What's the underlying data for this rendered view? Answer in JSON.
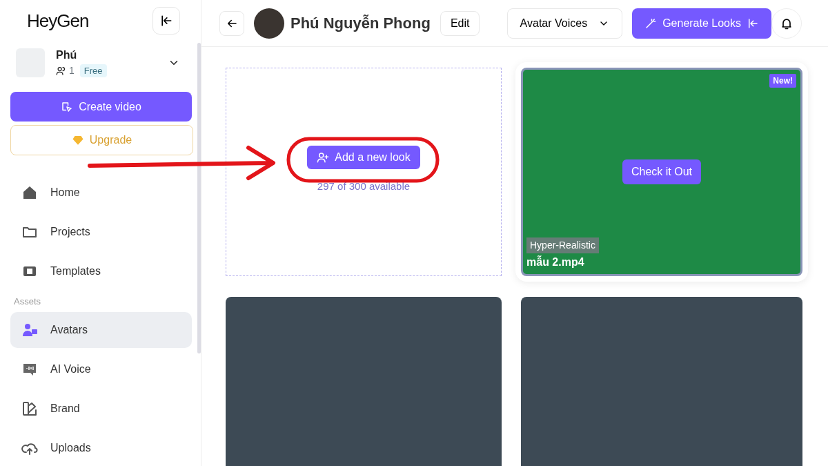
{
  "logo": {
    "text": "HeyGen"
  },
  "workspace": {
    "name": "Phú",
    "members": "1",
    "plan": "Free"
  },
  "sidebar": {
    "primary_action": "Create video",
    "upgrade": "Upgrade",
    "groups": [
      {
        "items": [
          {
            "label": "Home",
            "selected": false
          },
          {
            "label": "Projects",
            "selected": false
          },
          {
            "label": "Templates",
            "selected": false
          }
        ]
      },
      {
        "heading": "Assets",
        "items": [
          {
            "label": "Avatars",
            "selected": true
          },
          {
            "label": "AI Voice",
            "selected": false
          },
          {
            "label": "Brand",
            "selected": false
          },
          {
            "label": "Uploads",
            "selected": false
          }
        ]
      }
    ]
  },
  "header": {
    "name": "Phú Nguyễn Phong",
    "edit": "Edit",
    "voices": "Avatar Voices",
    "generate": "Generate Looks"
  },
  "looks": [
    {
      "kind": "add",
      "button": "Add a new look",
      "note": "297 of 300 available"
    },
    {
      "kind": "video",
      "selected": true,
      "badge": "New!",
      "action": "Check it Out",
      "tag": "Hyper-Realistic",
      "filename": "mẫu 2.mp4"
    },
    {
      "kind": "video",
      "selected": false
    },
    {
      "kind": "video",
      "selected": false
    }
  ],
  "annotations": {
    "arrow": {
      "color": "#e3151a"
    },
    "highlight": {
      "color": "#e3151a"
    }
  }
}
